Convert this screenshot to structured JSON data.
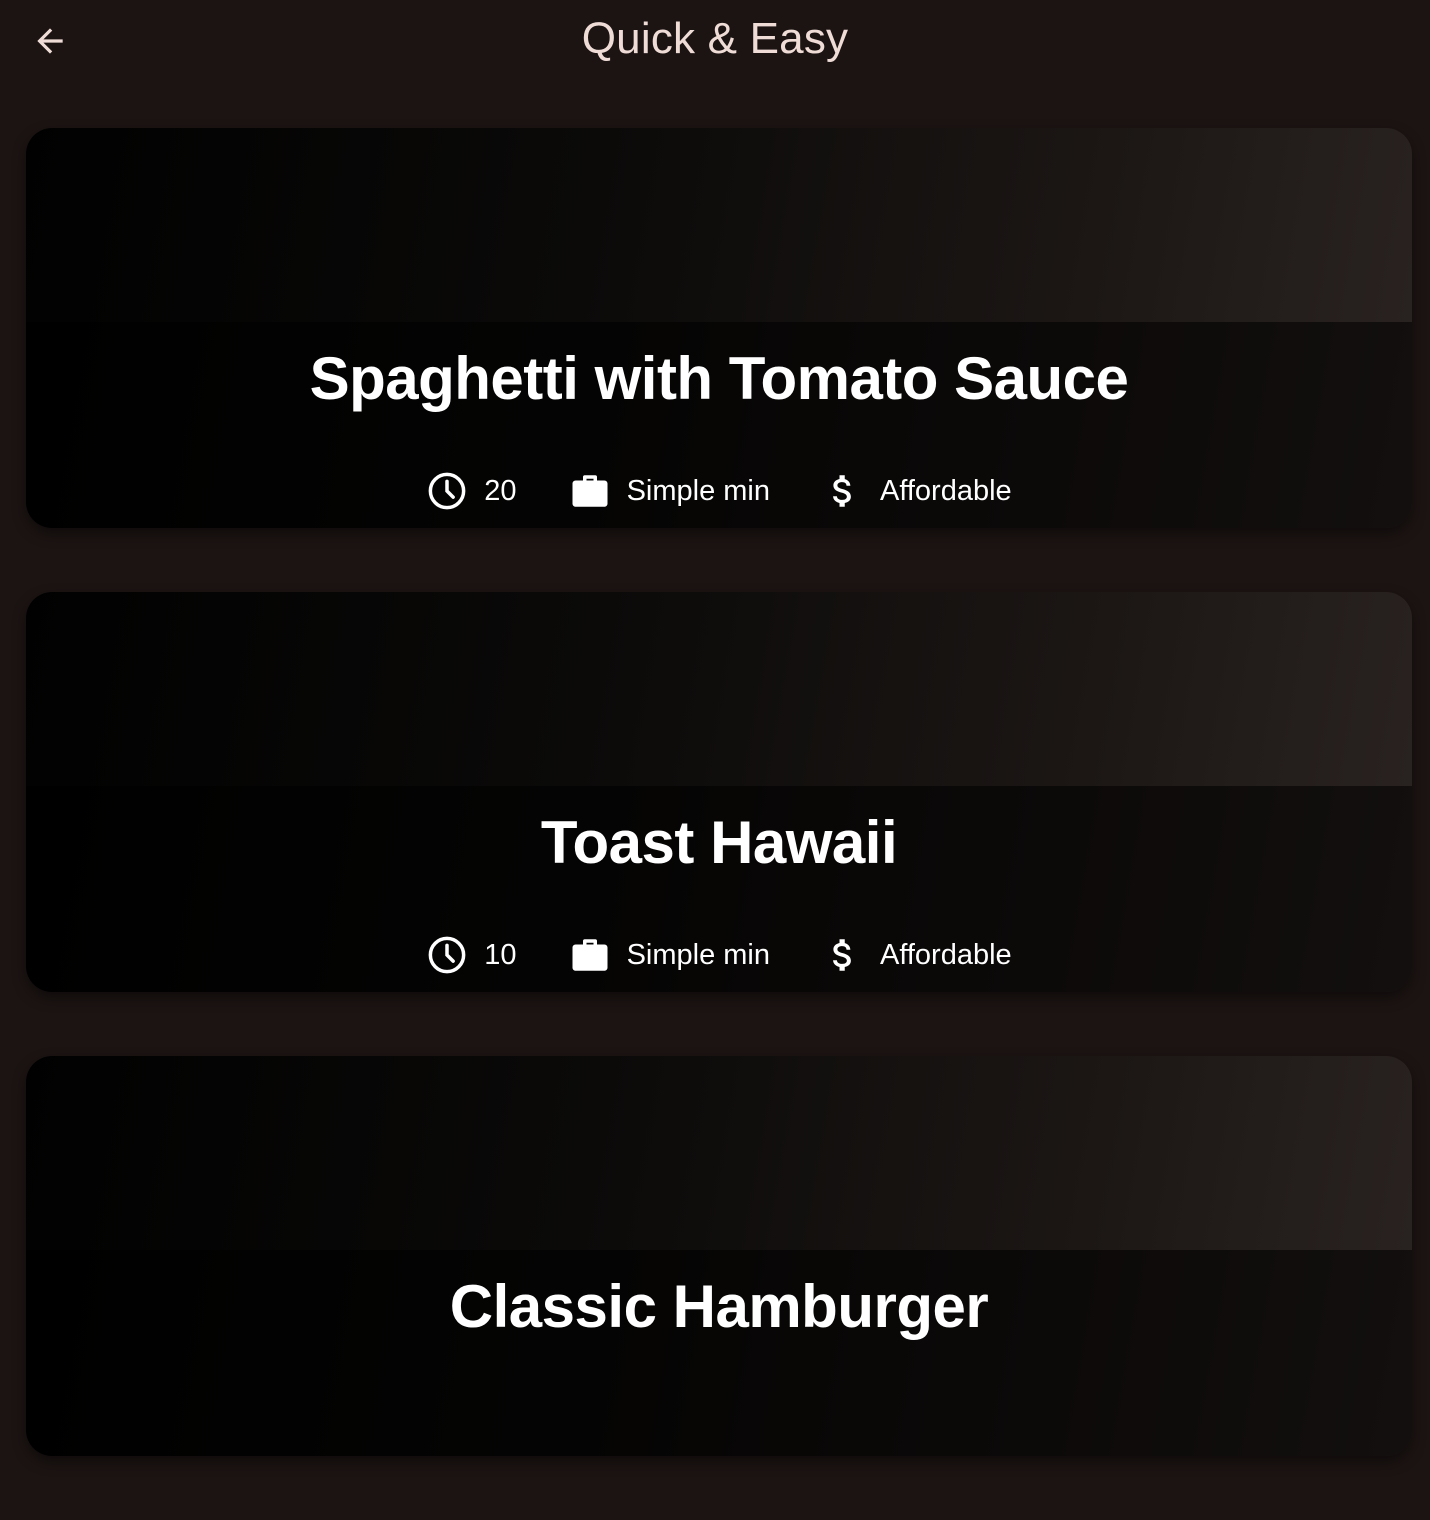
{
  "header": {
    "title": "Quick & Easy",
    "back_icon": "arrow-back-icon"
  },
  "meals": [
    {
      "title": "Spaghetti with Tomato Sauce",
      "duration": "20",
      "complexity": "Simple min",
      "affordability": "Affordable"
    },
    {
      "title": "Toast Hawaii",
      "duration": "10",
      "complexity": "Simple min",
      "affordability": "Affordable"
    },
    {
      "title": "Classic Hamburger"
    }
  ],
  "icons": {
    "duration": "clock-icon",
    "complexity": "briefcase-icon",
    "affordability": "dollar-icon"
  },
  "colors": {
    "background": "#1c1413",
    "title": "#efdcd6",
    "text": "#ffffff"
  }
}
